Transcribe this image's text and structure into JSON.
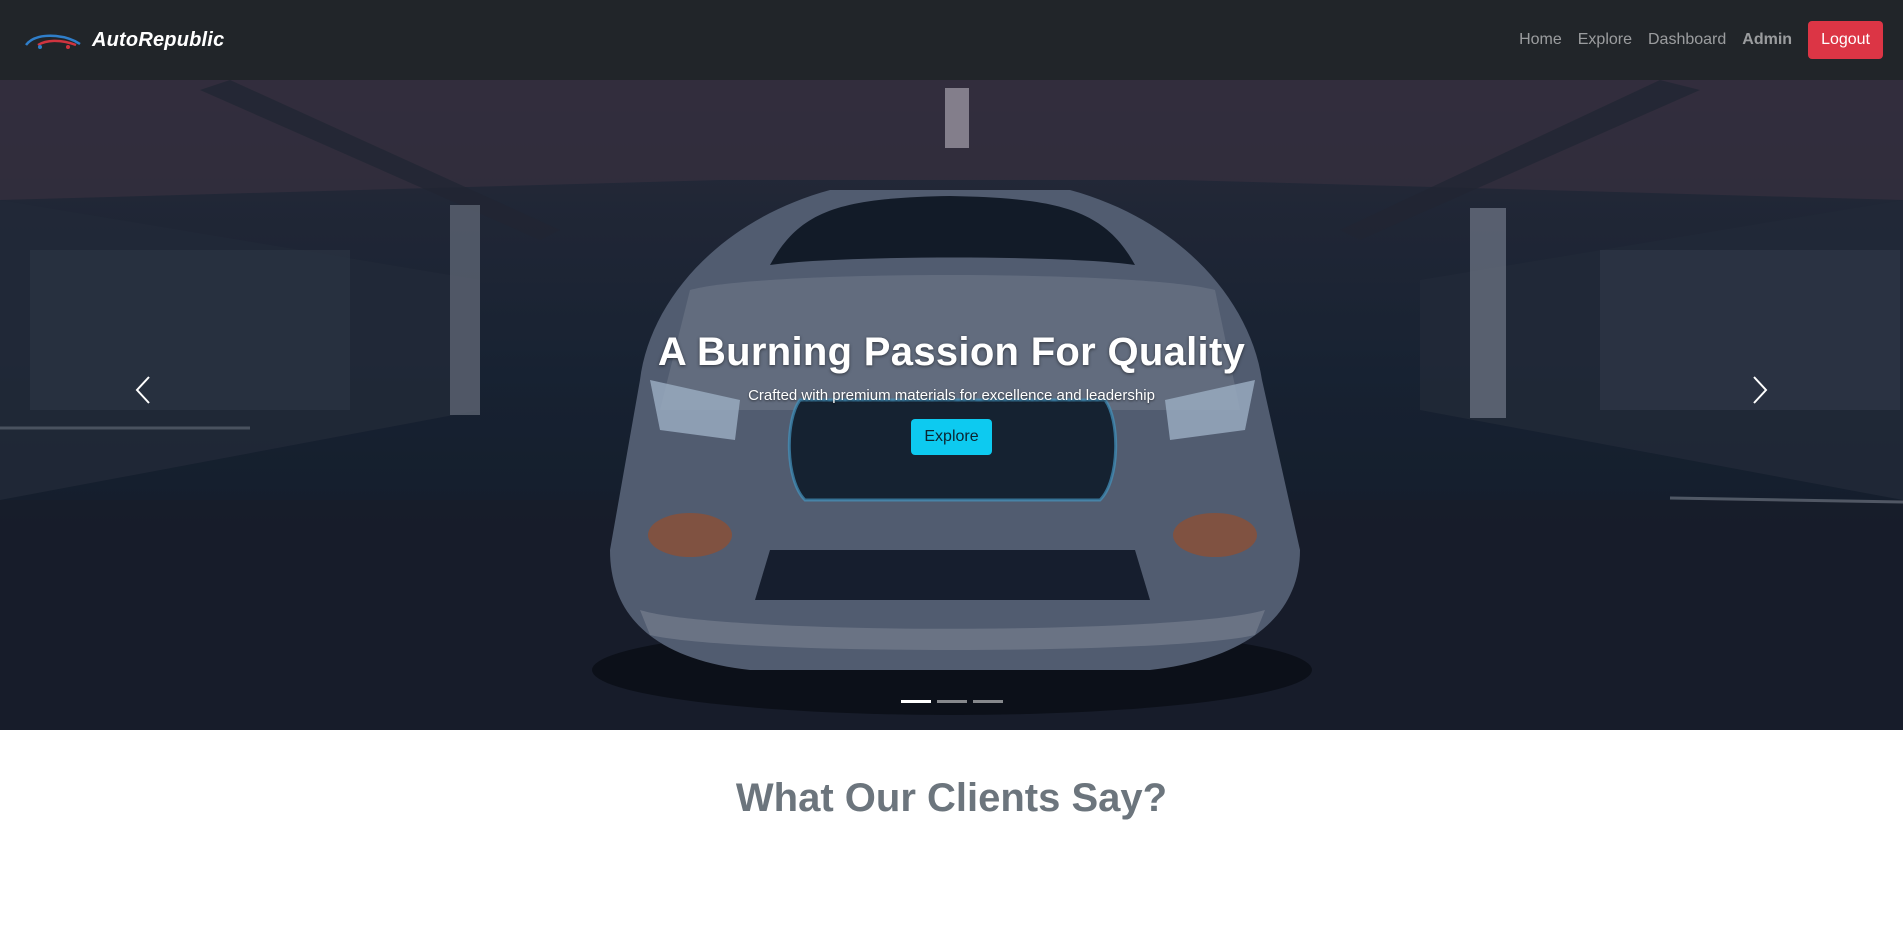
{
  "navbar": {
    "brand": "AutoRepublic",
    "links": [
      {
        "label": "Home"
      },
      {
        "label": "Explore"
      },
      {
        "label": "Dashboard"
      }
    ],
    "user": "Admin",
    "logout_label": "Logout"
  },
  "hero": {
    "title": "A Burning Passion For Quality",
    "subtitle": "Crafted with premium materials for excellence and leadership",
    "cta_label": "Explore",
    "slides_count": 3,
    "active_slide": 1
  },
  "testimonials": {
    "title": "What Our Clients Say?"
  },
  "colors": {
    "navbar_bg": "#212529",
    "logout": "#dc3545",
    "cta": "#0dcaf0",
    "heading_gray": "#6c757d"
  },
  "icons": {
    "brand": "car-logo-icon",
    "prev": "chevron-left-icon",
    "next": "chevron-right-icon"
  }
}
